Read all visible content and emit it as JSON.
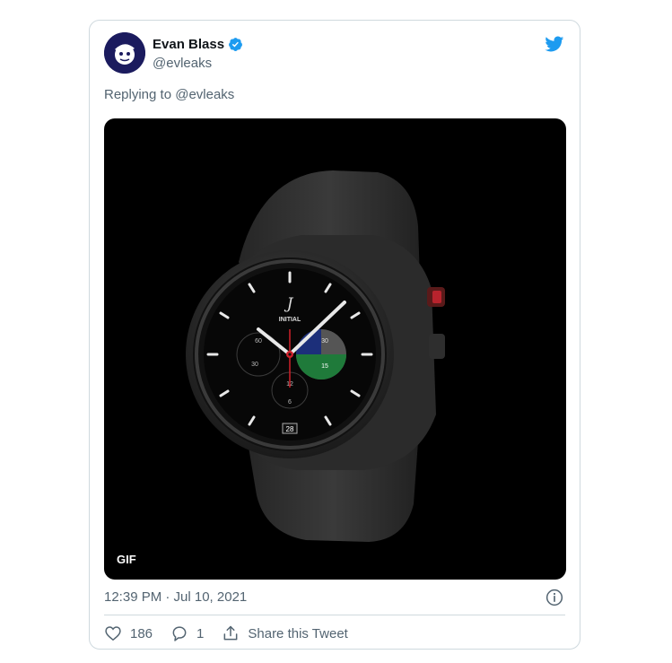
{
  "tweet": {
    "author": {
      "display_name": "Evan Blass",
      "handle": "@evleaks",
      "verified": true
    },
    "reply": {
      "prefix": "Replying to",
      "mention": "@evleaks"
    },
    "media": {
      "badge": "GIF",
      "watch_face": {
        "brand_mark": "J",
        "brand_label": "INITIAL",
        "subdial_labels": [
          "60",
          "30",
          "30",
          "15",
          "12",
          "6"
        ],
        "date": "28"
      }
    },
    "timestamp": "12:39 PM · Jul 10, 2021",
    "actions": {
      "like_count": "186",
      "reply_count": "1",
      "share_label": "Share this Tweet"
    }
  },
  "colors": {
    "brand": "#1d9bf0",
    "secondary_text": "#536471",
    "border": "#cfd9de"
  },
  "icons": [
    "verified-badge-icon",
    "twitter-bird-icon",
    "info-icon",
    "heart-icon",
    "reply-icon",
    "share-icon"
  ]
}
